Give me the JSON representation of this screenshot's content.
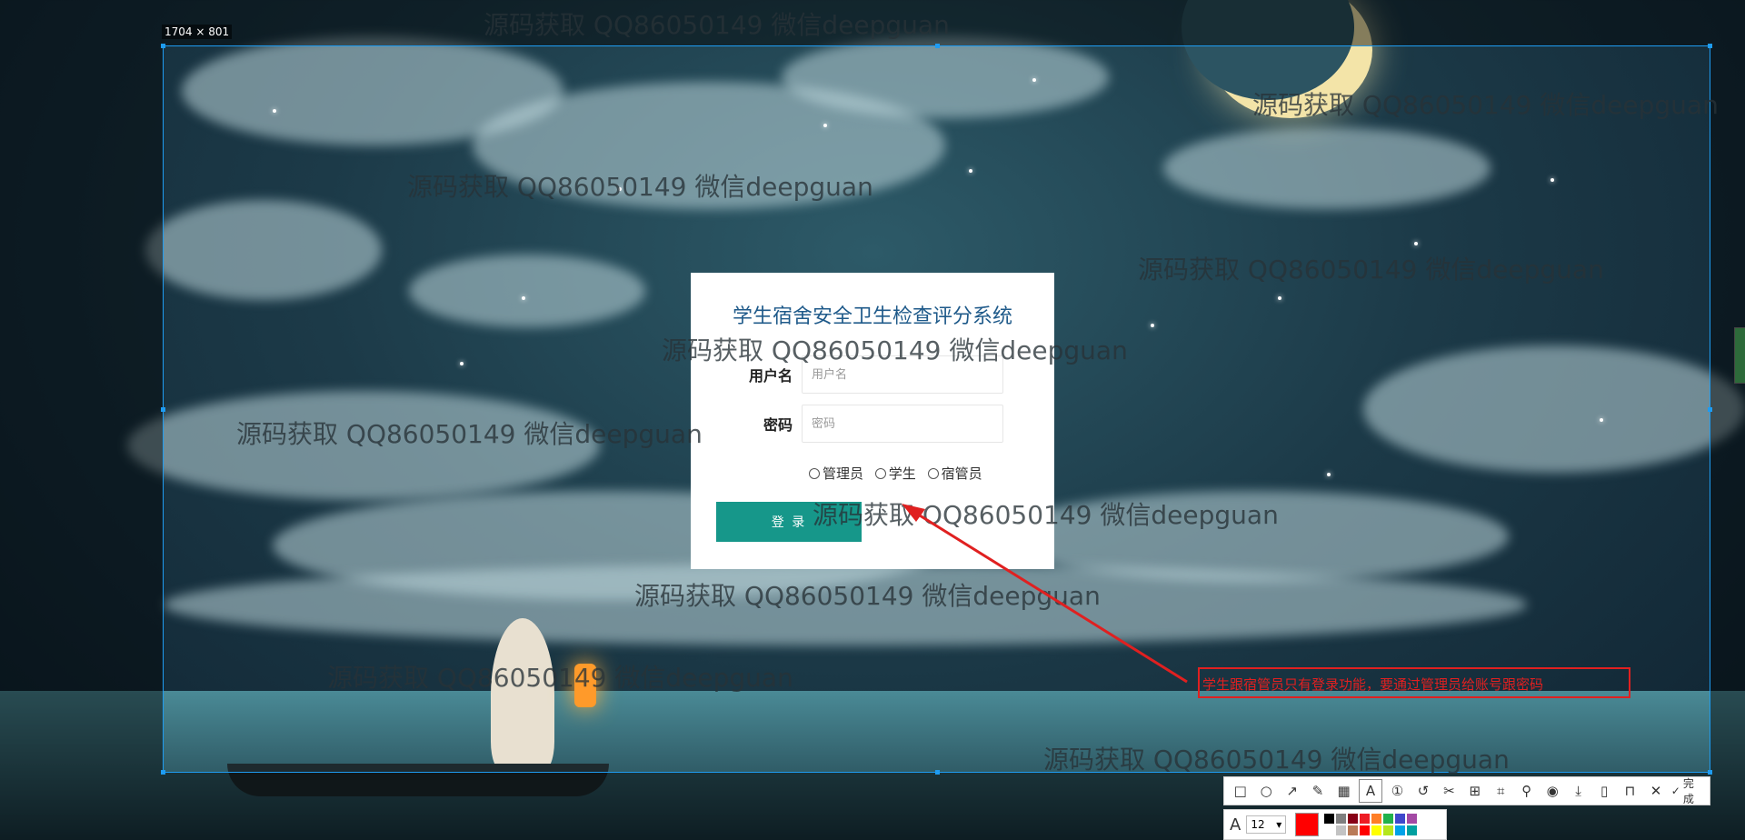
{
  "screenshot_tool": {
    "selection_size": "1704 × 801",
    "annotation_text": "学生跟宿管员只有登录功能，要通过管理员给账号跟密码",
    "font_size_value": "12",
    "current_color": "#ff0000",
    "palette": [
      "#000000",
      "#7f7f7f",
      "#880015",
      "#ed1c24",
      "#ff7f27",
      "#22b14c",
      "#3f48cc",
      "#a349a4",
      "#ffffff",
      "#c3c3c3",
      "#b97a57",
      "#ff0000",
      "#ffff00",
      "#b5e61d",
      "#00a2e8",
      "#00a0a0"
    ],
    "toolbar_tools": [
      "rectangle-icon",
      "ellipse-icon",
      "arrow-icon",
      "pen-icon",
      "mosaic-icon",
      "text-icon",
      "number-icon",
      "undo-icon",
      "cut-icon",
      "ocr-icon",
      "scan-icon",
      "pin-icon",
      "record-icon",
      "download-icon",
      "save-icon",
      "bookmark-icon",
      "close-icon"
    ],
    "finish_label": "完成"
  },
  "login": {
    "title": "学生宿舍安全卫生检查评分系统",
    "username_label": "用户名",
    "username_placeholder": "用户名",
    "password_label": "密码",
    "password_placeholder": "密码",
    "roles": [
      "管理员",
      "学生",
      "宿管员"
    ],
    "login_button": "登 录"
  },
  "watermark_text": "源码获取 QQ86050149 微信deepguan"
}
